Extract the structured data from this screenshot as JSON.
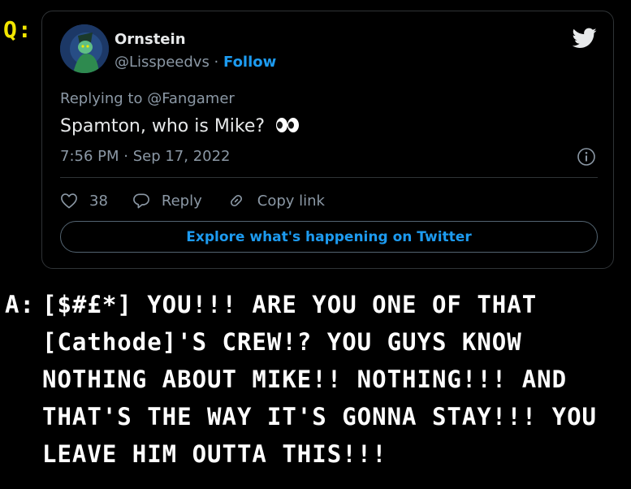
{
  "question_label": "Q:",
  "tweet": {
    "author_name": "Ornstein",
    "author_handle": "@Lisspeedvs",
    "separator": " · ",
    "follow_label": "Follow",
    "replying_to": "Replying to @Fangamer",
    "text": "Spamton, who is Mike?",
    "timestamp": "7:56 PM · Sep 17, 2022",
    "likes_count": "38",
    "reply_label": "Reply",
    "copy_link_label": "Copy link",
    "explore_label": "Explore what's happening on Twitter",
    "icons": {
      "brand": "twitter-bird-icon",
      "info": "info-icon",
      "like": "heart-icon",
      "reply": "reply-bubble-icon",
      "link": "link-icon",
      "emoji": "eyes-emoji"
    },
    "colors": {
      "accent": "#1d9bf0",
      "muted": "#8b98a5",
      "border": "#2f3336"
    }
  },
  "answer_label": "A:",
  "answer_text": "[$#£*] YOU!!! ARE YOU ONE OF THAT\n[Cathode]'S CREW!? YOU GUYS KNOW\nNOTHING ABOUT MIKE!! NOTHING!!! AND\nTHAT'S THE WAY IT'S GONNA STAY!!! YOU\nLEAVE HIM OUTTA THIS!!!",
  "colors": {
    "question_label": "#f2e600",
    "background": "#000000",
    "answer_text": "#ffffff"
  }
}
